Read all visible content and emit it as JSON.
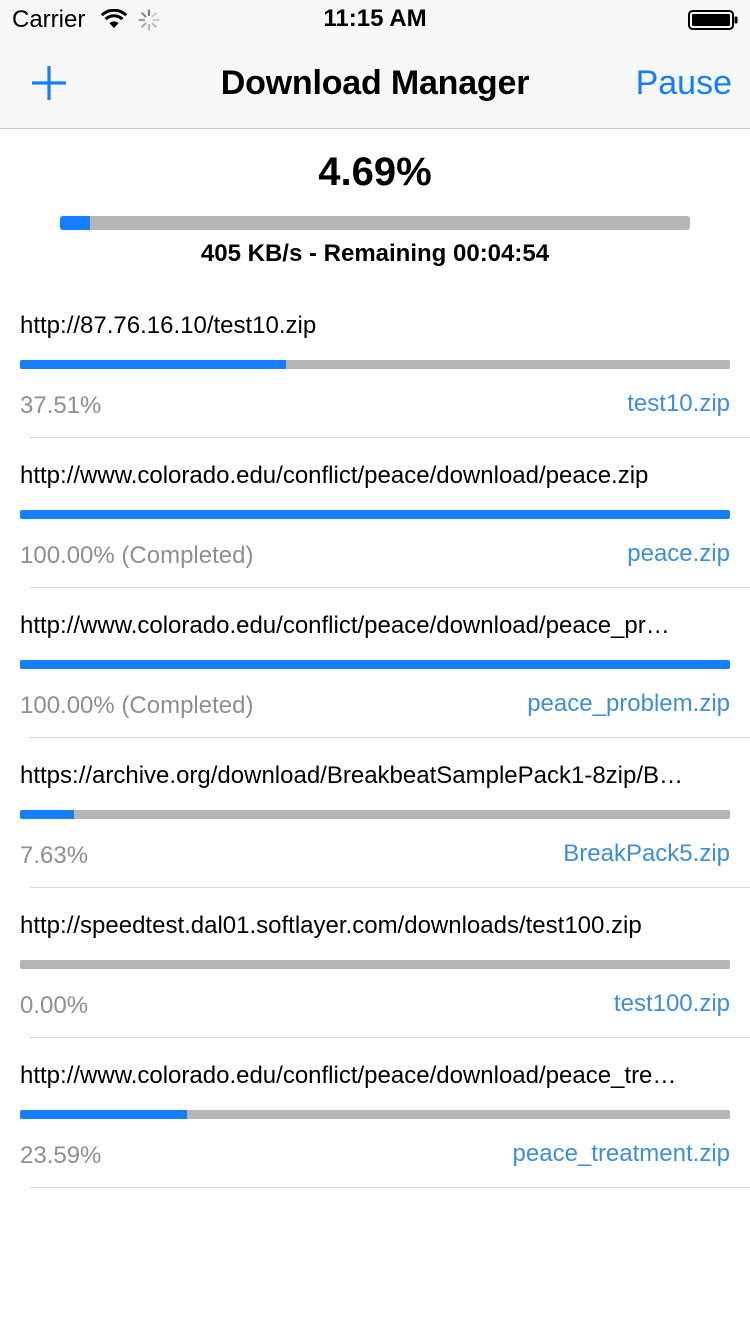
{
  "status_bar": {
    "carrier": "Carrier",
    "time": "11:15 AM"
  },
  "nav": {
    "title": "Download Manager",
    "pause_label": "Pause",
    "add_icon": "plus-icon"
  },
  "overall": {
    "percent_text": "4.69%",
    "progress": 0.0469,
    "speed_text": "405 KB/s - Remaining 00:04:54"
  },
  "colors": {
    "accent": "#147efb",
    "file_link": "#3d8fd1",
    "track": "#b5b5b5",
    "secondary_text": "#8e8e93"
  },
  "downloads": [
    {
      "url": "http://87.76.16.10/test10.zip",
      "progress": 0.3751,
      "status": "37.51%",
      "file": "test10.zip"
    },
    {
      "url": "http://www.colorado.edu/conflict/peace/download/peace.zip",
      "progress": 1.0,
      "status": "100.00% (Completed)",
      "file": "peace.zip"
    },
    {
      "url": "http://www.colorado.edu/conflict/peace/download/peace_pr…",
      "progress": 1.0,
      "status": "100.00% (Completed)",
      "file": "peace_problem.zip"
    },
    {
      "url": "https://archive.org/download/BreakbeatSamplePack1-8zip/B…",
      "progress": 0.0763,
      "status": "7.63%",
      "file": "BreakPack5.zip"
    },
    {
      "url": "http://speedtest.dal01.softlayer.com/downloads/test100.zip",
      "progress": 0.0,
      "status": "0.00%",
      "file": "test100.zip"
    },
    {
      "url": "http://www.colorado.edu/conflict/peace/download/peace_tre…",
      "progress": 0.2359,
      "status": "23.59%",
      "file": "peace_treatment.zip"
    }
  ]
}
